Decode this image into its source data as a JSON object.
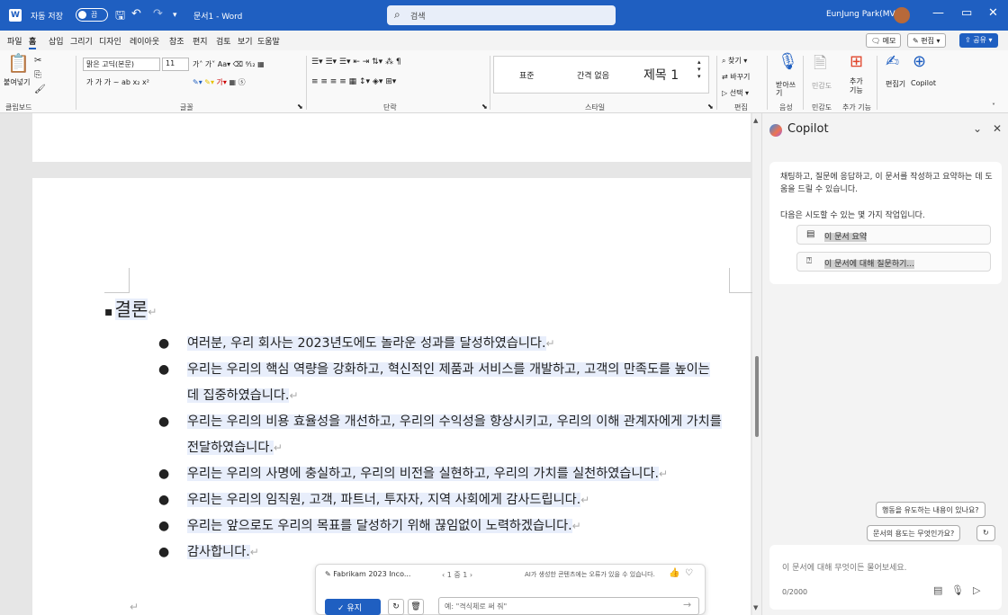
{
  "titlebar": {
    "app_icon": "W",
    "autosave_label": "자동 저장",
    "autosave_state": "끔",
    "doc_name": "문서1 - Word",
    "search_placeholder": "검색",
    "user": "EunJung Park(MVP)",
    "minimize": "—",
    "restore": "▭",
    "close": "✕"
  },
  "menu": {
    "items": [
      "파일",
      "홈",
      "삽입",
      "그리기",
      "디자인",
      "레이아웃",
      "참조",
      "편지",
      "검토",
      "보기",
      "도움말"
    ],
    "memo": "메모",
    "edit": "편집",
    "share": "공유"
  },
  "ribbon": {
    "paste": "붙여넣기",
    "font_name": "맑은 고딕(본문)",
    "font_size": "11",
    "format_row": "가  가  가 ~ ab  x₂  x²",
    "style_normal": "표준",
    "style_nospacing": "간격 없음",
    "style_heading1": "제목 1",
    "find": "찾기",
    "replace": "바꾸기",
    "select": "선택",
    "dictate": "받아쓰기",
    "sensitivity": "민감도",
    "addins": "추가 기능",
    "editor": "편집기",
    "copilot": "Copilot",
    "groups": {
      "clipboard": "클립보드",
      "font": "글꼴",
      "paragraph": "단락",
      "styles": "스타일",
      "editing": "편집",
      "voice": "음성",
      "sensitivity": "민감도",
      "addins": "추가 기능"
    }
  },
  "document": {
    "heading": "결론",
    "bullets": [
      "여러분, 우리 회사는 2023년도에도 놀라운 성과를 달성하였습니다.",
      "우리는 우리의 핵심 역량을 강화하고, 혁신적인 제품과 서비스를 개발하고, 고객의 만족도를 높이는 데 집중하였습니다.",
      "우리는 우리의 비용 효율성을 개선하고, 우리의 수익성을 향상시키고, 우리의 이해 관계자에게 가치를 전달하였습니다.",
      "우리는 우리의 사명에 충실하고, 우리의 비전을 실현하고, 우리의 가치를 실천하였습니다.",
      "우리는 우리의 임직원, 고객, 파트너, 투자자, 지역 사회에게 감사드립니다.",
      "우리는 앞으로도 우리의 목표를 달성하기 위해 끊임없이 노력하겠습니다.",
      "감사합니다."
    ]
  },
  "floating": {
    "source": "Fabrikam 2023 Inco...",
    "pager": "1 중 1",
    "disclaimer": "AI가 생성한 콘텐츠에는 오류가 있을 수 있습니다.",
    "keep": "유지",
    "input_placeholder": "예: \"격식체로 써 줘\""
  },
  "copilot": {
    "title": "Copilot",
    "intro": "채팅하고, 질문에 응답하고, 이 문서를 작성하고 요약하는 데 도움을 드릴 수 있습니다.",
    "subtitle": "다음은 시도할 수 있는 몇 가지 작업입니다.",
    "suggestion1": "이 문서 요약",
    "suggestion2": "이 문서에 대해 질문하기...",
    "pill1": "행동을 유도하는 내용이 있나요?",
    "pill2": "문서의 용도는 무엇인가요?",
    "input_placeholder": "이 문서에 대해 무엇이든 물어보세요.",
    "counter": "0/2000"
  }
}
